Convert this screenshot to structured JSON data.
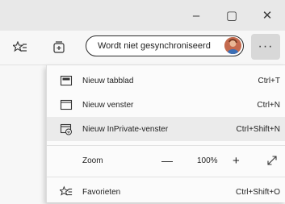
{
  "window": {
    "minimize_glyph": "–",
    "maximize_glyph": "▢",
    "close_glyph": "✕"
  },
  "toolbar": {
    "profile_status": "Wordt niet gesynchroniseerd",
    "more_glyph": "···"
  },
  "menu": {
    "items": [
      {
        "icon": "new-tab-icon",
        "label": "Nieuw tabblad",
        "shortcut": "Ctrl+T"
      },
      {
        "icon": "new-window-icon",
        "label": "Nieuw venster",
        "shortcut": "Ctrl+N"
      },
      {
        "icon": "inprivate-window-icon",
        "label": "Nieuw InPrivate-venster",
        "shortcut": "Ctrl+Shift+N"
      }
    ],
    "zoom": {
      "label": "Zoom",
      "minus": "—",
      "value": "100%",
      "plus": "+"
    },
    "favorites": {
      "icon": "favorites-icon",
      "label": "Favorieten",
      "shortcut": "Ctrl+Shift+O"
    }
  },
  "colors": {
    "titlebar": "#e8e8e8",
    "toolbar": "#f7f7f7",
    "menu_bg": "#fbfbfb",
    "hover_bg": "#ebebeb",
    "more_active_bg": "#d8d8d8"
  }
}
